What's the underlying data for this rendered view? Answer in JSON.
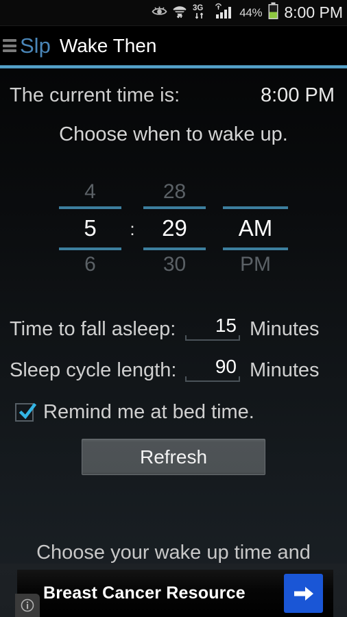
{
  "status_bar": {
    "icons": [
      "eye-icon",
      "wifi-icon",
      "3g-icon",
      "signal-icon",
      "battery-icon"
    ],
    "network_type": "3G",
    "battery_percent": "44%",
    "clock": "8:00 PM"
  },
  "action_bar": {
    "menu_icon": "hamburger-icon",
    "logo_text": "Slp",
    "title": "Wake Then",
    "accent_color": "#58a7cf"
  },
  "content": {
    "current_time_label": "The current time is:",
    "current_time_value": "8:00 PM",
    "instruction": "Choose when to wake up.",
    "time_picker": {
      "hour": {
        "prev": "4",
        "selected": "5",
        "next": "6"
      },
      "separator": ":",
      "minute": {
        "prev": "28",
        "selected": "29",
        "next": "30"
      },
      "meridiem": {
        "prev": "",
        "selected": "AM",
        "next": "PM"
      },
      "rule_color": "#3d7f9e"
    },
    "settings": [
      {
        "label": "Time to fall asleep:",
        "value": "15",
        "unit": "Minutes"
      },
      {
        "label": "Sleep cycle length:",
        "value": "90",
        "unit": "Minutes"
      }
    ],
    "remind": {
      "checked": true,
      "label": "Remind me at bed time.",
      "check_color": "#33b5e5"
    },
    "refresh_label": "Refresh",
    "description_clipped": "Choose your wake up time and"
  },
  "ad": {
    "headline": "Breast Cancer Resource",
    "cta_icon": "arrow-right-icon",
    "info_icon": "info-icon",
    "cta_color": "#1a56d6"
  }
}
